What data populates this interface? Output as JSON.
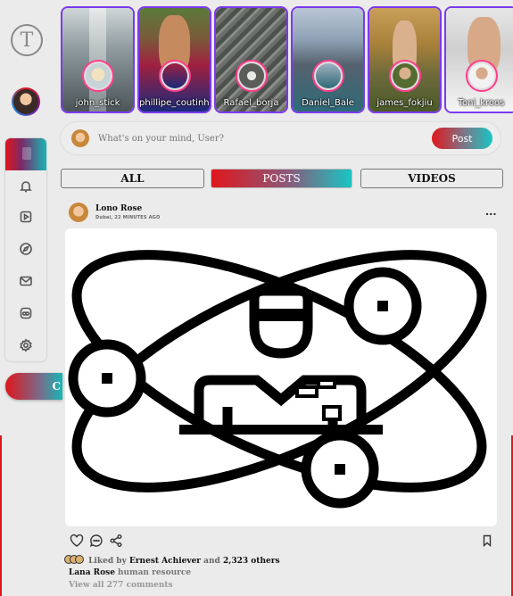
{
  "app": {
    "logo_letter": "T"
  },
  "sidebar": {
    "items": [
      {
        "icon": "home-icon"
      },
      {
        "icon": "bell-icon"
      },
      {
        "icon": "video-icon"
      },
      {
        "icon": "compass-icon"
      },
      {
        "icon": "mail-icon"
      },
      {
        "icon": "group-icon"
      },
      {
        "icon": "gear-icon"
      }
    ],
    "create_label": "C"
  },
  "stories": [
    {
      "name": "john_stick"
    },
    {
      "name": "phillipe_coutinho"
    },
    {
      "name": "Rafael_borja"
    },
    {
      "name": "Daniel_Bale"
    },
    {
      "name": "james_fokjiu"
    },
    {
      "name": "Toni_kroos"
    }
  ],
  "composer": {
    "placeholder": "What's on your mind, User?",
    "post_label": "Post"
  },
  "tabs": [
    {
      "label": "ALL",
      "active": false
    },
    {
      "label": "POSTS",
      "active": true
    },
    {
      "label": "VIDEOS",
      "active": false
    }
  ],
  "post": {
    "author": "Lono Rose",
    "meta": "Dubai, 22 MINUTES AGO",
    "more": "...",
    "liked_prefix": "Liked by",
    "liked_user": "Ernest Achiever",
    "liked_and": "and",
    "liked_others": "2,323 others",
    "caption_user": "Lana Rose",
    "caption_text": "human resource",
    "comments_link": "View all 277 comments"
  },
  "colors": {
    "accent_red": "#e0161c",
    "accent_teal": "#18c6c4",
    "story_border": "#7c3aed"
  }
}
